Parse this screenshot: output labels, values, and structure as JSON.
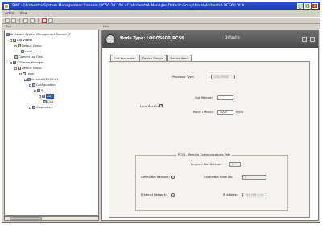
{
  "window": {
    "title": "SMC - [Archestra System Management Console (PC56 28 106 4C)\\ArchestrA Manager\\Default Group\\Local\\ArchestrA.PCS6\\LOCA..."
  },
  "menu": {
    "action": "Action",
    "view": "View"
  },
  "toolbar": {
    "label": "View"
  },
  "panes": {
    "tree_header": "Tree",
    "right_header": "Link"
  },
  "tree": {
    "root": "ArchestrA System Management Console (P",
    "log_viewer": "Log Viewer",
    "default_group_1": "Default Group",
    "local_1": "Local",
    "opened_log_files": "Opened Log Files",
    "dam": "DAServer Manager",
    "default_group_2": "Default Group",
    "local_2": "Local",
    "archestra_node": "ArchestrA.PCS6.1.1",
    "configuration": "Configuration",
    "ip": "IP",
    "item_a": "CLI1",
    "item_b": "CLI1",
    "diagnostics": "Diagnostics"
  },
  "banner": {
    "title": "Node Type: LOGO5600_PCS6",
    "tag": "Defaults"
  },
  "tabs": [
    "CLI6 Parameter",
    "Device Groups",
    "Device Items"
  ],
  "form": {
    "processor_type_label": "Processor Type:",
    "processor_type_value": "LOGO5600",
    "local_rack_label": "Local Rack/slot",
    "local_rack_checked": "✓",
    "slot_number_label": "Slot Number:",
    "slot_number_value": "3",
    "reply_timeout_label": "Reply Timeout:",
    "reply_timeout_value": "5000",
    "reply_timeout_unit": "MSec",
    "group_title": "PC56 - Remote Communications Path",
    "program_slot_label": "Program Slot Number:",
    "program_slot_value": "0",
    "controlnet_label": "ControlNet Network:",
    "controlnet_node_label": "ControlNet Node No:",
    "controlnet_node_value": "0",
    "ethernet_label": "Ethernet Network:",
    "ip_label": "IP Address:",
    "ip_value": "192.168.0.10"
  }
}
